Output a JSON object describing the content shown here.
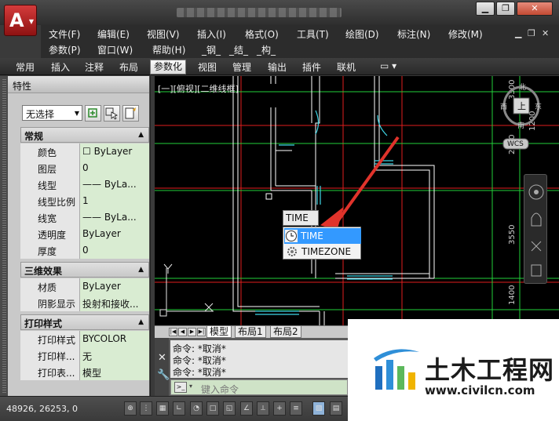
{
  "colors": {
    "canvas_bg": "#000000",
    "grid_red": "#e01e1e",
    "grid_green": "#22d03a",
    "wall": "#ffffff",
    "window_cyan": "#3fd6e6",
    "arrow_red": "#e0332b",
    "selection_blue": "#3399ff",
    "value_green": "#d9ecd2"
  },
  "menu": {
    "row1": [
      "文件(F)",
      "编辑(E)",
      "视图(V)",
      "插入(I)",
      "格式(O)",
      "工具(T)",
      "绘图(D)",
      "标注(N)",
      "修改(M)"
    ],
    "row2": [
      "参数(P)",
      "窗口(W)",
      "帮助(H)",
      "_钢_",
      "_结_",
      "_构_"
    ]
  },
  "ribbon": {
    "tabs": [
      "常用",
      "插入",
      "注释",
      "布局",
      "参数化",
      "视图",
      "管理",
      "输出",
      "插件",
      "联机"
    ],
    "active": "参数化"
  },
  "properties": {
    "title": "特性",
    "selection": "无选择",
    "sections": [
      {
        "title": "常规",
        "rows": [
          {
            "label": "颜色",
            "value": "☐ ByLayer"
          },
          {
            "label": "图层",
            "value": "0"
          },
          {
            "label": "线型",
            "value": "—— ByLa..."
          },
          {
            "label": "线型比例",
            "value": "1"
          },
          {
            "label": "线宽",
            "value": "—— ByLa..."
          },
          {
            "label": "透明度",
            "value": "ByLayer"
          },
          {
            "label": "厚度",
            "value": "0"
          }
        ]
      },
      {
        "title": "三维效果",
        "rows": [
          {
            "label": "材质",
            "value": "ByLayer"
          },
          {
            "label": "阴影显示",
            "value": "投射和接收..."
          }
        ]
      },
      {
        "title": "打印样式",
        "rows": [
          {
            "label": "打印样式",
            "value": "BYCOLOR"
          },
          {
            "label": "打印样...",
            "value": "无"
          },
          {
            "label": "打印表...",
            "value": "模型"
          }
        ]
      }
    ]
  },
  "viewport": {
    "label": "[一][俯视][二维线框]",
    "wcs": "WCS",
    "cube_top": "上",
    "compass": {
      "n": "北",
      "w": "西",
      "e": "东",
      "s": "南"
    },
    "dims": [
      "3300",
      "1200",
      "2250",
      "3550",
      "1400"
    ]
  },
  "autocomplete": {
    "typed": "TIME",
    "options": [
      {
        "label": "TIME",
        "icon": "clock-icon",
        "selected": true
      },
      {
        "label": "TIMEZONE",
        "icon": "gear-icon",
        "selected": false
      }
    ]
  },
  "layout_tabs": [
    "模型",
    "布局1",
    "布局2"
  ],
  "command": {
    "history": [
      "命令: *取消*",
      "命令: *取消*",
      "命令: *取消*"
    ],
    "placeholder": "键入命令"
  },
  "status": {
    "coords": "48926, 26253, 0"
  },
  "watermark": {
    "title": "土木工程网",
    "url": "www.civilcn.com"
  }
}
